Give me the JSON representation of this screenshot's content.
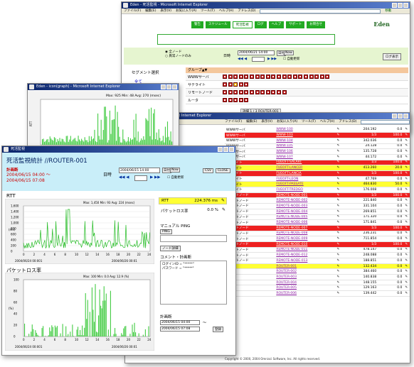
{
  "win_back": {
    "title": "Eden - 死活監視 - Microsoft Internet Explorer",
    "menu": [
      "ファイル(F)",
      "編集(E)",
      "表示(V)",
      "お気に入り(A)",
      "ツール(T)",
      "ヘルプ(H)",
      "アドレス(D)"
    ],
    "go": "移動",
    "nav_tabs": [
      "警告",
      "スケジュール",
      "死活監視",
      "ログ",
      "ヘルプ",
      "サポート",
      "お問合せ"
    ],
    "logo": "Eden",
    "radio_1": "全ノード",
    "radio_2": "異常ノードのみ",
    "date_label": "日時",
    "date_value": "2004/06/21 14:00",
    "date_btn": "日付",
    "now_btn": "Now",
    "auto": "自動更新",
    "right_btn": "ログ表示",
    "segment_label": "セグメント選択",
    "all_link": "全て",
    "group_header": "グループ▲▼",
    "groups": [
      {
        "name": "WWWサーバ",
        "boxes": "ggggggggggggrggggggg"
      },
      {
        "name": "サテライト",
        "boxes": "ggyrg"
      },
      {
        "name": "リモートノード",
        "boxes": "gggggrgggggg"
      },
      {
        "name": "ルータ",
        "boxes": "ggggg"
      }
    ],
    "bottom_btns": "詳細 1 / 3 ROUTER-001"
  },
  "win_small": {
    "title": "Eden - icon(graph) - Microsoft Internet Explorer",
    "legend": "Max: 925 Min: 48 Avg: 270 (msec)",
    "x_labels": [
      "1",
      "2",
      "3",
      "4",
      "5",
      "6",
      "7",
      "8",
      "9"
    ],
    "date_left": "2004/06/20 00:4617",
    "date_right": "2004/06/20 00:20:4517",
    "axis_label": "RTT"
  },
  "win_list": {
    "title": "Eden - 死活監視 - Microsoft Internet Explorer",
    "menu": [
      "ファイル(F)",
      "編集(E)",
      "表示(V)",
      "お気に入り(A)",
      "ツール(T)",
      "ヘルプ(H)",
      "アドレス(D)"
    ],
    "rows": [
      [
        "外部",
        "WWWサーバ",
        "WWW-100",
        "204.192",
        "0.0",
        "w"
      ],
      [
        "外部",
        "WWWサーバ",
        "WWW-103",
        "1/3",
        "100.0",
        "r"
      ],
      [
        "WWWサーバ",
        "WWW-104",
        "",
        "342.036",
        "0.0",
        "w"
      ],
      [
        "WWWサーバ",
        "WWW-105",
        "",
        "24.128",
        "0.0",
        "w"
      ],
      [
        "WWWサーバ",
        "WWW-106",
        "",
        "135.728",
        "0.0",
        "w"
      ],
      [
        "WWWサーバ",
        "WWW-107",
        "",
        "44.172",
        "0.0",
        "w"
      ],
      [
        "サテライト",
        "FUEOFT-SALART",
        "",
        "1/3",
        "100.0",
        "r"
      ],
      [
        "サテライト",
        "FUEOFT-LANCER",
        "",
        "413.260",
        "20.0",
        "y"
      ],
      [
        "サテライト",
        "FUEOFT-LANCIA",
        "",
        "1/3",
        "100.0",
        "r"
      ],
      [
        "サテライト",
        "FUEOFT-LEON",
        "",
        "47.769",
        "0.0",
        "w"
      ],
      [
        "サテライト",
        "FUEOFT-PASSATE",
        "",
        "464.830",
        "50.0",
        "y"
      ],
      [
        "サテライト",
        "FUEOFT-TREDGO",
        "",
        "176.008",
        "0.0",
        "w"
      ],
      [
        "リモートノード",
        "REMOTE-NODE-001",
        "",
        "1/3",
        "100.0",
        "r"
      ],
      [
        "リモートノード",
        "REMOTE-NODE-002",
        "",
        "221.840",
        "0.0",
        "w"
      ],
      [
        "リモートノード",
        "REMOTE-NODE-003",
        "",
        "331.104",
        "0.0",
        "w"
      ],
      [
        "リモートノード",
        "REMOTE-NODE-004",
        "",
        "269.851",
        "0.0",
        "w"
      ],
      [
        "リモートノード",
        "REMOTE-NODE-005",
        "",
        "171.320",
        "0.0",
        "w"
      ],
      [
        "リモートノード",
        "REMOTE-NODE-006",
        "",
        "171.841",
        "0.0",
        "w"
      ],
      [
        "リモートノード",
        "REMOTE-NODE-007",
        "",
        "1/3",
        "100.0",
        "r"
      ],
      [
        "リモートノード",
        "REMOTE-NODE-008",
        "",
        "236.231",
        "0.0",
        "w"
      ],
      [
        "リモートノード",
        "REMOTE-NODE-009",
        "",
        "711.854",
        "0.0",
        "w"
      ],
      [
        "リモートノード",
        "REMOTE-NODE-010",
        "",
        "1/3",
        "100.0",
        "r"
      ],
      [
        "リモートノード",
        "REMOTE-NODE-011",
        "",
        "478.147",
        "0.0",
        "w"
      ],
      [
        "リモートノード",
        "REMOTE-NODE-012",
        "",
        "248.088",
        "0.0",
        "w"
      ],
      [
        "リモートノード",
        "REMOTE-NODE-013",
        "",
        "188.851",
        "0.0",
        "w"
      ],
      [
        "ルータ",
        "ROUTER-001",
        "",
        "132.434",
        "0.0",
        "y"
      ],
      [
        "ルータ",
        "ROUTER-002",
        "",
        "384.460",
        "0.0",
        "w"
      ],
      [
        "ルータ",
        "ROUTER-003",
        "",
        "140.838",
        "0.0",
        "w"
      ],
      [
        "ルータ",
        "ROUTER-004",
        "",
        "148.155",
        "0.0",
        "w"
      ],
      [
        "ルータ",
        "ROUTER-005",
        "",
        "129.163",
        "0.0",
        "w"
      ],
      [
        "ルータ",
        "ROUTER-006",
        "",
        "139.442",
        "0.0",
        "w"
      ]
    ],
    "footer": "Copyright © 2000, 2004 Omnisci Software, Inc. All rights reserved."
  },
  "win_front": {
    "title": "死活監視",
    "heading": "死活監視統計 //ROUTER-001",
    "status_label": "計画断",
    "status_text": "2004/06/15 04:00 〜\n2004/06/15 07:08",
    "date_label": "日時",
    "date_value": "2004/06/15 14:00",
    "date_btn": "日付",
    "now_btn": "Now",
    "auto": "自動更新",
    "btn1": "CSV",
    "btn2": "CLOSE",
    "rtt_title": "RTT",
    "rtt_legend": "Max: 1,450 Min: 93 Avg: 224 (msec)",
    "rtt_y": [
      "1,600",
      "1,400",
      "1,200",
      "1,000",
      "800",
      "600",
      "400",
      "200",
      "0"
    ],
    "rtt_x": [
      "0",
      "2",
      "4",
      "6",
      "8",
      "10",
      "12",
      "14",
      "16",
      "18",
      "20",
      "22",
      "24"
    ],
    "rtt_ylabel": "(ms)",
    "date_l": "2004/06/24 00:001",
    "date_r": "2004/06/26 00:01",
    "loss_title": "パケットロス率",
    "loss_legend": "Max: 100 Min: 0.0 Avg: 12.9 (%)",
    "loss_y": [
      "100",
      "80",
      "60",
      "40",
      "20",
      "0"
    ],
    "loss_ylabel": "(%)",
    "rtt_label": "RTT",
    "rtt_value": "224.376 ms",
    "loss_label": "パケットロス率",
    "loss_value": "0.0 %",
    "manual_ping": "マニュアル PING",
    "ping_btn": "PING",
    "node_btn": "ノード詳細",
    "comment_label": "コメント・計画断",
    "comment_text": "ログインID = \"*****\"\nパスワード = \"*****\"",
    "plan_label": "計画断",
    "plan_1": "2004/06/15 04:00",
    "plan_2": "2004/06/15 07:08",
    "plan_tilde": "〜",
    "plan_btn": "登録"
  }
}
